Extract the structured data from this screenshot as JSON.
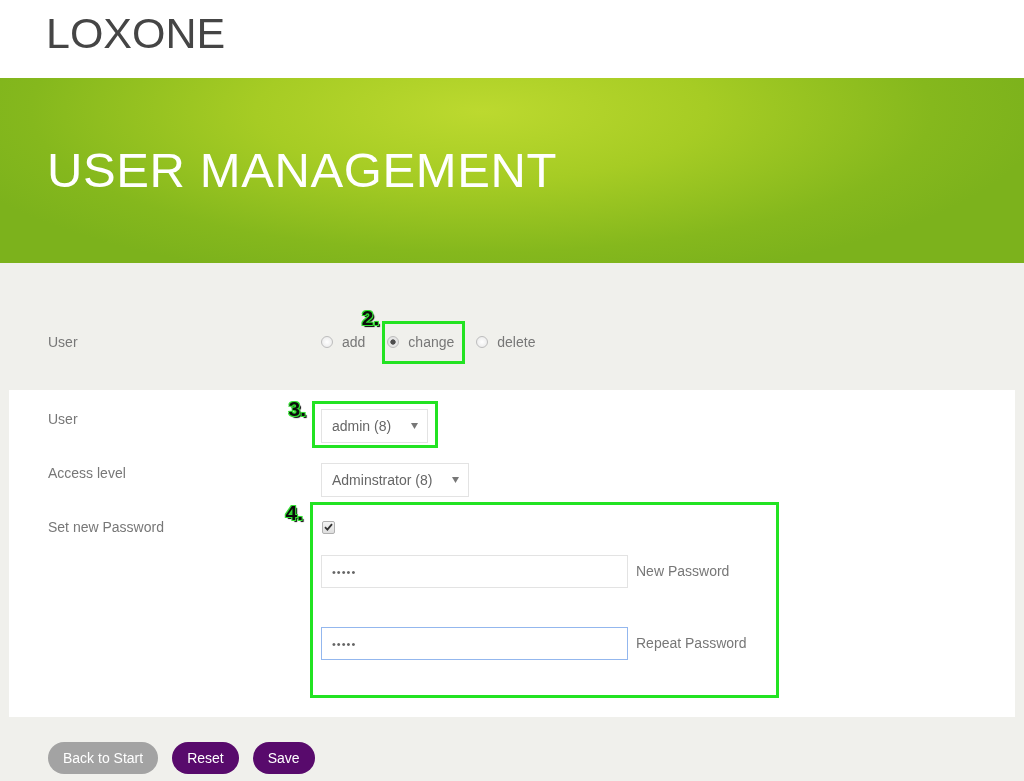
{
  "header": {
    "logo": "LOXONE"
  },
  "banner": {
    "title": "USER MANAGEMENT"
  },
  "mode": {
    "label": "User",
    "options": [
      {
        "label": "add",
        "selected": false
      },
      {
        "label": "change",
        "selected": true,
        "callout": "2."
      },
      {
        "label": "delete",
        "selected": false
      }
    ]
  },
  "form": {
    "rows": [
      {
        "kind": "select",
        "label": "User",
        "value": "admin (8)",
        "callout": "3."
      },
      {
        "kind": "select",
        "label": "Access level",
        "value": "Adminstrator (8)"
      },
      {
        "kind": "password",
        "label": "Set new Password",
        "checked": true,
        "callout": "4.",
        "fields": [
          {
            "value": "•••••",
            "label": "New Password",
            "focused": false
          },
          {
            "value": "•••••",
            "label": "Repeat Password",
            "focused": true
          }
        ]
      }
    ]
  },
  "buttons": [
    {
      "label": "Back to Start",
      "kind": "secondary"
    },
    {
      "label": "Reset",
      "kind": "primary"
    },
    {
      "label": "Save",
      "kind": "primary"
    }
  ]
}
